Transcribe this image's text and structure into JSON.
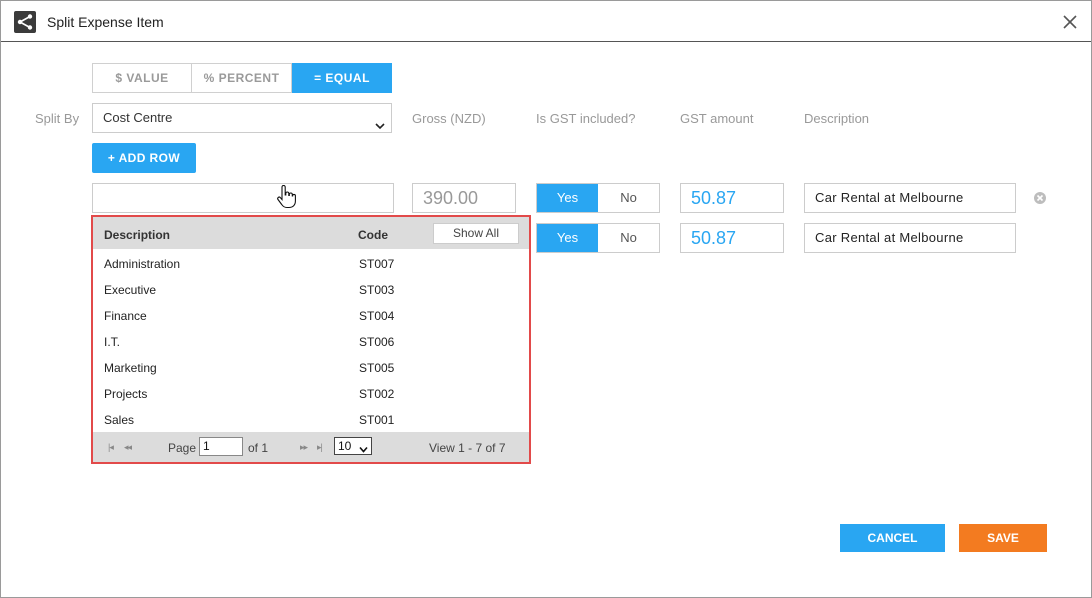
{
  "window": {
    "title": "Split Expense Item",
    "app_icon": "share-split-icon",
    "close_icon": "close-icon"
  },
  "split_mode": {
    "options": [
      "$ VALUE",
      "% PERCENT",
      "= EQUAL"
    ],
    "selected": "= EQUAL"
  },
  "labels": {
    "split_by": "Split By",
    "gross": "Gross (NZD)",
    "gst_included": "Is GST included?",
    "gst_amount": "GST amount",
    "description": "Description"
  },
  "split_by_select": {
    "value": "Cost Centre"
  },
  "add_row_label": "+ ADD ROW",
  "rows": [
    {
      "cost_centre": "",
      "gross": "390.00",
      "gst_yes": "Yes",
      "gst_no": "No",
      "gst_amount": "50.87",
      "description": "Car Rental at Melbourne"
    },
    {
      "gst_yes": "Yes",
      "gst_no": "No",
      "gst_amount": "50.87",
      "description": "Car Rental at Melbourne"
    }
  ],
  "lookup": {
    "columns": {
      "description": "Description",
      "code": "Code"
    },
    "show_all_label": "Show All",
    "items": [
      {
        "description": "Administration",
        "code": "ST007"
      },
      {
        "description": "Executive",
        "code": "ST003"
      },
      {
        "description": "Finance",
        "code": "ST004"
      },
      {
        "description": "I.T.",
        "code": "ST006"
      },
      {
        "description": "Marketing",
        "code": "ST005"
      },
      {
        "description": "Projects",
        "code": "ST002"
      },
      {
        "description": "Sales",
        "code": "ST001"
      }
    ],
    "pager": {
      "page_label": "Page",
      "page_value": "1",
      "of_label": "of 1",
      "page_size": "10",
      "view_text": "View 1 - 7 of 7"
    }
  },
  "footer": {
    "cancel_label": "CANCEL",
    "save_label": "SAVE"
  },
  "colors": {
    "accent": "#29a6f2",
    "save": "#f37b20",
    "highlight_border": "#e24a4a"
  }
}
